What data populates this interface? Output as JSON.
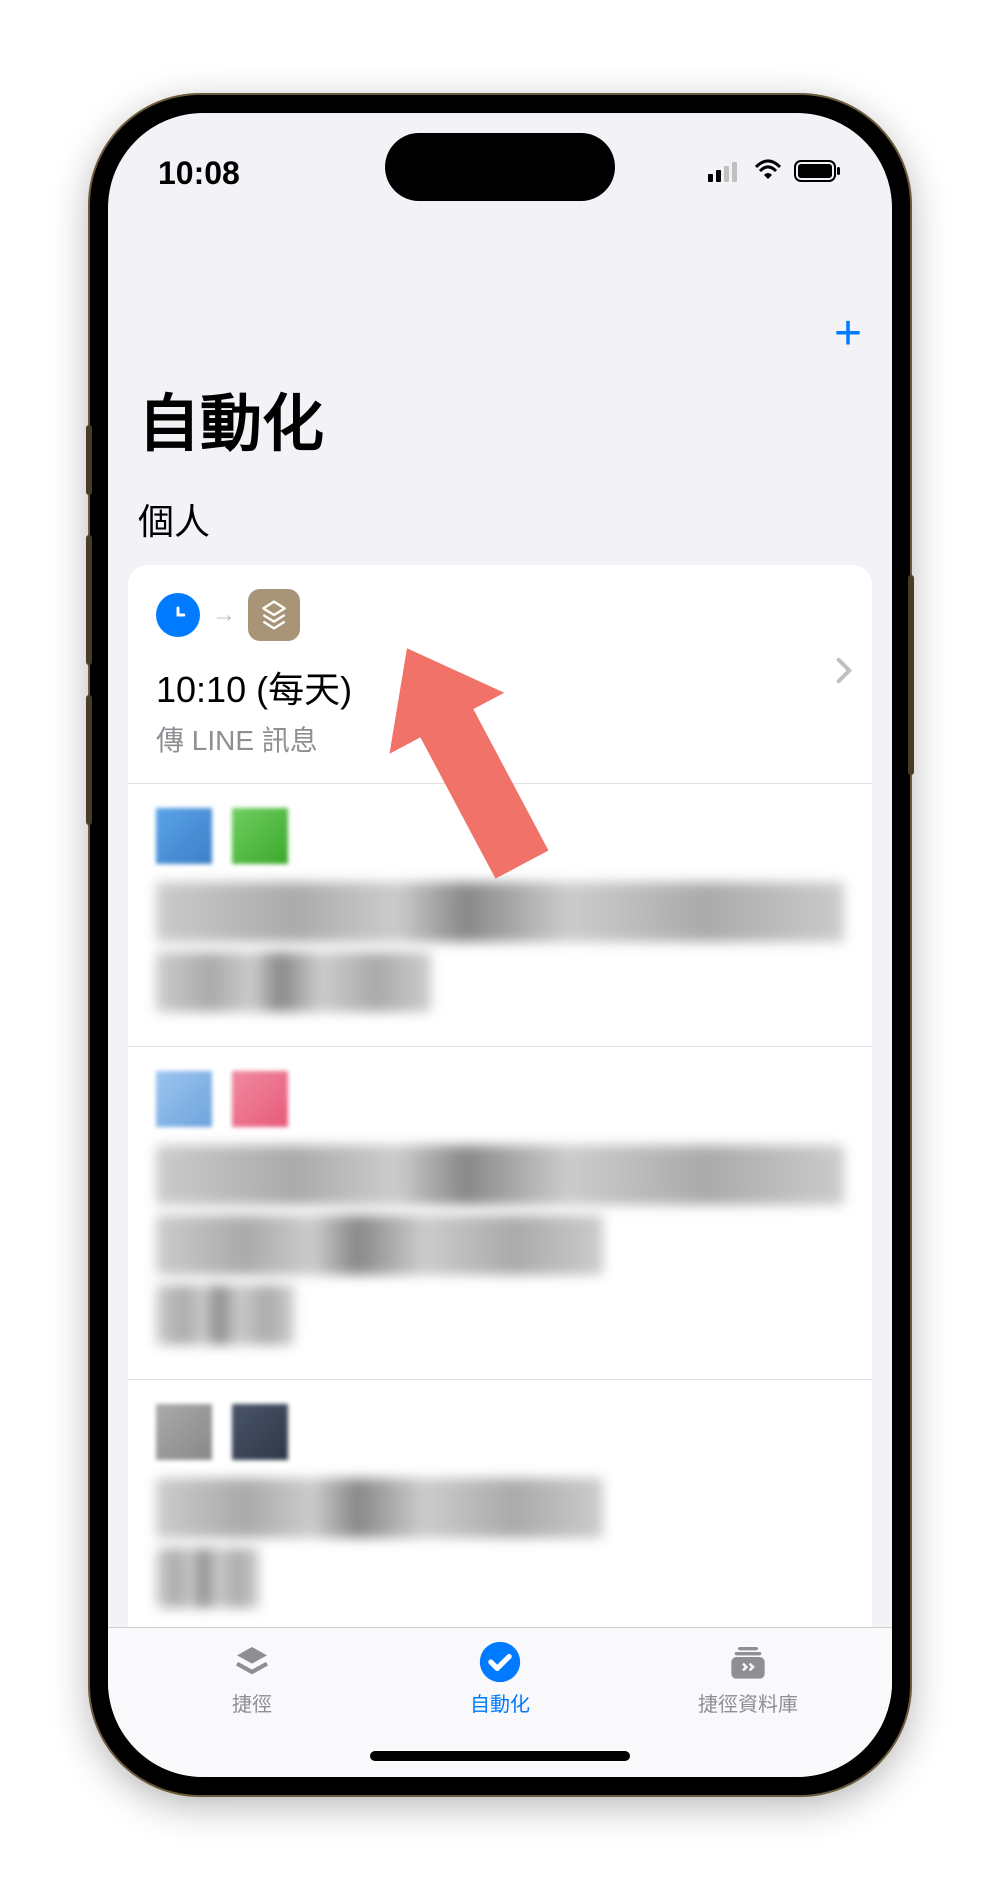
{
  "status": {
    "time": "10:08"
  },
  "header": {
    "title": "自動化",
    "section": "個人"
  },
  "automation": {
    "first": {
      "title": "10:10 (每天)",
      "subtitle": "傳 LINE 訊息"
    }
  },
  "tabs": {
    "shortcuts": "捷徑",
    "automation": "自動化",
    "gallery": "捷徑資料庫"
  },
  "icons": {
    "clock": "clock-icon",
    "shortcut": "shortcut-icon",
    "add": "+"
  }
}
